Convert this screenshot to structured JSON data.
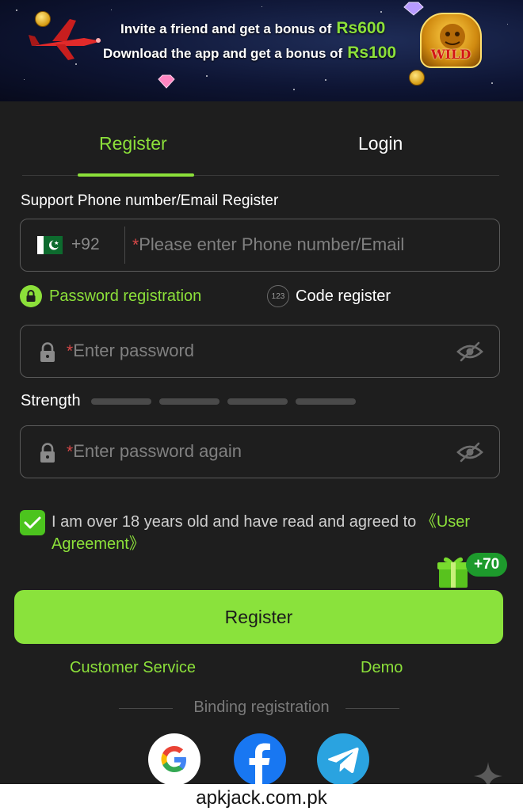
{
  "banner": {
    "line1_text": "Invite a friend and get a bonus of",
    "line1_amount": "Rs600",
    "line2_text": "Download the app and get a bonus of",
    "line2_amount": "Rs100",
    "wild_label": "WILD"
  },
  "tabs": [
    {
      "label": "Register",
      "active": true
    },
    {
      "label": "Login",
      "active": false
    }
  ],
  "form": {
    "support_label": "Support Phone number/Email Register",
    "country_code": "+92",
    "required_mark": "*",
    "phone_placeholder": "Please enter Phone number/Email",
    "mode_password_label": "Password registration",
    "mode_code_label": "Code register",
    "mode_code_icon_text": "123",
    "password_placeholder": "Enter password",
    "strength_label": "Strength",
    "strength_level": 0,
    "confirm_placeholder": "Enter password again",
    "agree_text": "I am over 18 years old and have read and agreed to ",
    "agree_link": "《User Agreement》",
    "agree_checked": true
  },
  "bonus_badge": "+70",
  "register_button": "Register",
  "links": {
    "customer_service": "Customer Service",
    "demo": "Demo"
  },
  "binding_label": "Binding registration",
  "social": [
    "google-icon",
    "facebook-icon",
    "telegram-icon"
  ],
  "footer_watermark": "apkjack.com.pk",
  "colors": {
    "accent": "#8ce03a",
    "background": "#1e1e1e",
    "checkbox": "#4cc41e"
  }
}
